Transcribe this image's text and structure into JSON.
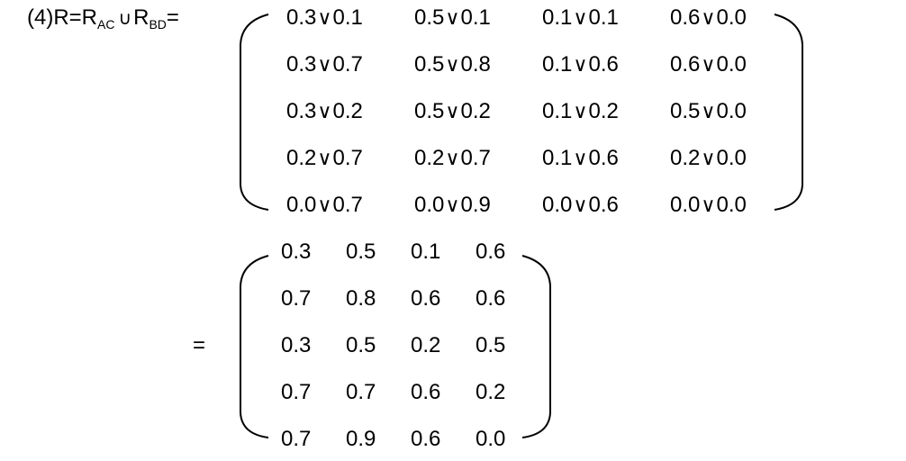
{
  "equation_label": {
    "prefix": "(4)R=R",
    "sub1": "AC",
    "union_symbol": "∪",
    "mid": "R",
    "sub2": "BD",
    "equals": "="
  },
  "or_symbol": "∨",
  "matrix_ops": [
    [
      [
        "0.3",
        "0.1"
      ],
      [
        "0.5",
        "0.1"
      ],
      [
        "0.1",
        "0.1"
      ],
      [
        "0.6",
        "0.0"
      ]
    ],
    [
      [
        "0.3",
        "0.7"
      ],
      [
        "0.5",
        "0.8"
      ],
      [
        "0.1",
        "0.6"
      ],
      [
        "0.6",
        "0.0"
      ]
    ],
    [
      [
        "0.3",
        "0.2"
      ],
      [
        "0.5",
        "0.2"
      ],
      [
        "0.1",
        "0.2"
      ],
      [
        "0.5",
        "0.0"
      ]
    ],
    [
      [
        "0.2",
        "0.7"
      ],
      [
        "0.2",
        "0.7"
      ],
      [
        "0.1",
        "0.6"
      ],
      [
        "0.2",
        "0.0"
      ]
    ],
    [
      [
        "0.0",
        "0.7"
      ],
      [
        "0.0",
        "0.9"
      ],
      [
        "0.0",
        "0.6"
      ],
      [
        "0.0",
        "0.0"
      ]
    ]
  ],
  "result_equals": "=",
  "matrix_result": [
    [
      "0.3",
      "0.5",
      "0.1",
      "0.6"
    ],
    [
      "0.7",
      "0.8",
      "0.6",
      "0.6"
    ],
    [
      "0.3",
      "0.5",
      "0.2",
      "0.5"
    ],
    [
      "0.7",
      "0.7",
      "0.6",
      "0.2"
    ],
    [
      "0.7",
      "0.9",
      "0.6",
      "0.0"
    ]
  ]
}
